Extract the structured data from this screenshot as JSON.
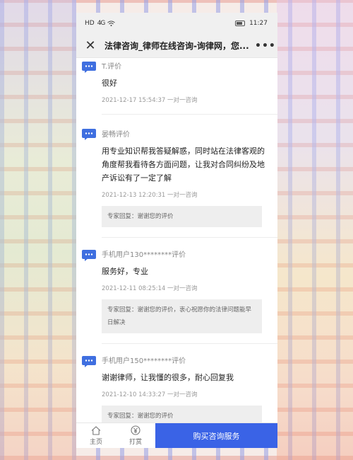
{
  "status_bar": {
    "network_label": "HD",
    "signal_label": "4G",
    "time": "11:27"
  },
  "header": {
    "title": "法律咨询_律师在线咨询-询律网，您...",
    "close_icon": "close-icon",
    "more_icon": "more-icon"
  },
  "reviews": [
    {
      "name": "T.评价",
      "text": "很好",
      "meta": "2021-12-17 15:54:37 一对一咨询",
      "reply": ""
    },
    {
      "name": "晏畅评价",
      "text": "用专业知识帮我答疑解惑，同时站在法律客观的角度帮我看待各方面问题，让我对合同纠纷及地产诉讼有了一定了解",
      "meta": "2021-12-13 12:20:31 一对一咨询",
      "reply": "专家回复：谢谢您的评价"
    },
    {
      "name": "手机用户130********评价",
      "text": "服务好，专业",
      "meta": "2021-12-11 08:25:14 一对一咨询",
      "reply": "专家回复：谢谢您的评价，衷心祝愿你的法律问题能早日解决"
    },
    {
      "name": "手机用户150********评价",
      "text": "谢谢律师，让我懂的很多，耐心回复我",
      "meta": "2021-12-10 14:33:27 一对一咨询",
      "reply": "专家回复：谢谢您的评价"
    }
  ],
  "bottom_bar": {
    "home_label": "主页",
    "tip_label": "打赏",
    "buy_label": "购买咨询服务"
  },
  "colors": {
    "accent": "#3a63e6",
    "review_icon": "#3f6fe0"
  }
}
